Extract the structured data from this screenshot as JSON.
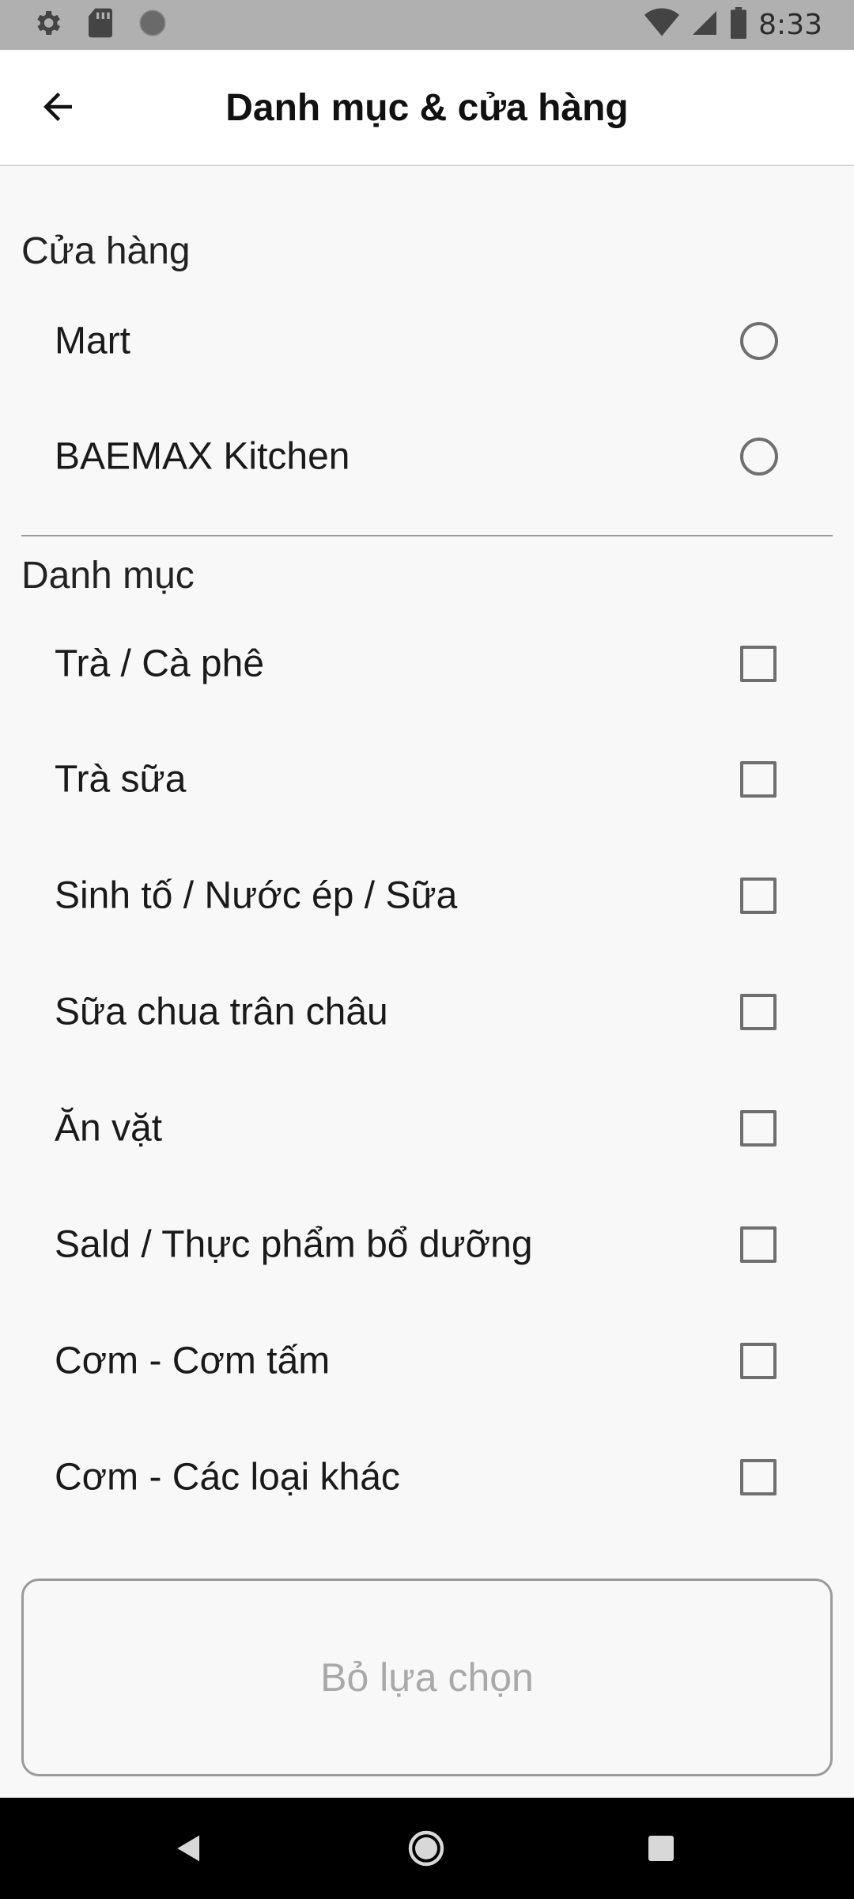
{
  "status_bar": {
    "time": "8:33",
    "left_icons": [
      "settings-icon",
      "sd-card-icon",
      "circle-icon"
    ],
    "right_icons": [
      "wifi-icon",
      "signal-icon",
      "battery-icon"
    ]
  },
  "app_bar": {
    "back_icon": "arrow-left-icon",
    "title": "Danh mục & cửa hàng"
  },
  "stores": {
    "title": "Cửa hàng",
    "items": [
      {
        "label": "Mart",
        "selected": false
      },
      {
        "label": "BAEMAX Kitchen",
        "selected": false
      }
    ]
  },
  "categories": {
    "title": "Danh mục",
    "items": [
      {
        "label": "Trà / Cà phê",
        "checked": false
      },
      {
        "label": "Trà sữa",
        "checked": false
      },
      {
        "label": "Sinh tố / Nước ép / Sữa",
        "checked": false
      },
      {
        "label": "Sữa chua trân châu",
        "checked": false
      },
      {
        "label": "Ăn vặt",
        "checked": false
      },
      {
        "label": "Sald / Thực phẩm bổ dưỡng",
        "checked": false
      },
      {
        "label": "Cơm - Cơm tấm",
        "checked": false
      },
      {
        "label": "Cơm - Các loại khác",
        "checked": false
      }
    ]
  },
  "clear_button": {
    "label": "Bỏ lựa chọn"
  },
  "nav_bar": {
    "icons": [
      "nav-back-icon",
      "nav-home-icon",
      "nav-recents-icon"
    ]
  },
  "colors": {
    "status_bar_bg": "#b0b0b0",
    "background": "#f8f8f8",
    "control_border": "#6f6f6f",
    "disabled_text": "#a9a9a9"
  }
}
